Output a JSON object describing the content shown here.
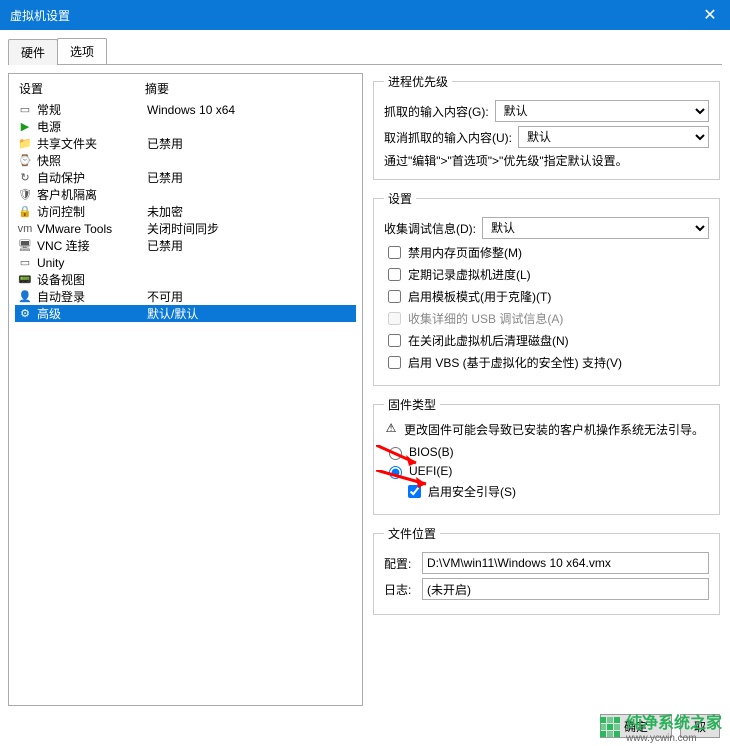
{
  "window": {
    "title": "虚拟机设置",
    "close_glyph": "✕"
  },
  "tabs": {
    "hardware": "硬件",
    "options": "选项"
  },
  "list": {
    "header_name": "设置",
    "header_summary": "摘要",
    "items": [
      {
        "icon": "▭",
        "name": "常规",
        "summary": "Windows 10 x64"
      },
      {
        "icon": "▶",
        "name": "电源",
        "summary": "",
        "icon_color": "#1a9e1a"
      },
      {
        "icon": "📁",
        "name": "共享文件夹",
        "summary": "已禁用"
      },
      {
        "icon": "⌚",
        "name": "快照",
        "summary": ""
      },
      {
        "icon": "↻",
        "name": "自动保护",
        "summary": "已禁用"
      },
      {
        "icon": "🛡",
        "name": "客户机隔离",
        "summary": ""
      },
      {
        "icon": "🔒",
        "name": "访问控制",
        "summary": "未加密"
      },
      {
        "icon": "vm",
        "name": "VMware Tools",
        "summary": "关闭时间同步"
      },
      {
        "icon": "🖥",
        "name": "VNC 连接",
        "summary": "已禁用"
      },
      {
        "icon": "▭",
        "name": "Unity",
        "summary": ""
      },
      {
        "icon": "📟",
        "name": "设备视图",
        "summary": ""
      },
      {
        "icon": "👤",
        "name": "自动登录",
        "summary": "不可用"
      },
      {
        "icon": "⚙",
        "name": "高级",
        "summary": "默认/默认"
      }
    ]
  },
  "priority": {
    "legend": "进程优先级",
    "grabbed_label": "抓取的输入内容(G):",
    "grabbed_value": "默认",
    "ungrabbed_label": "取消抓取的输入内容(U):",
    "ungrabbed_value": "默认",
    "note": "通过\"编辑\">\"首选项\">\"优先级\"指定默认设置。"
  },
  "settings": {
    "legend": "设置",
    "debug_label": "收集调试信息(D):",
    "debug_value": "默认",
    "cb_mem": "禁用内存页面修整(M)",
    "cb_log": "定期记录虚拟机进度(L)",
    "cb_template": "启用模板模式(用于克隆)(T)",
    "cb_usb": "收集详细的 USB 调试信息(A)",
    "cb_clean": "在关闭此虚拟机后清理磁盘(N)",
    "cb_vbs": "启用 VBS (基于虚拟化的安全性) 支持(V)"
  },
  "firmware": {
    "legend": "固件类型",
    "warn": "更改固件可能会导致已安装的客户机操作系统无法引导。",
    "rb_bios": "BIOS(B)",
    "rb_uefi": "UEFI(E)",
    "cb_secure": "启用安全引导(S)"
  },
  "filelocation": {
    "legend": "文件位置",
    "cfg_label": "配置:",
    "cfg_value": "D:\\VM\\win11\\Windows 10 x64.vmx",
    "log_label": "日志:",
    "log_value": "(未开启)"
  },
  "buttons": {
    "ok": "确定",
    "cancel": "取"
  },
  "watermark": {
    "brand": "纯净系统之家",
    "url": "www.ycwin.com"
  }
}
